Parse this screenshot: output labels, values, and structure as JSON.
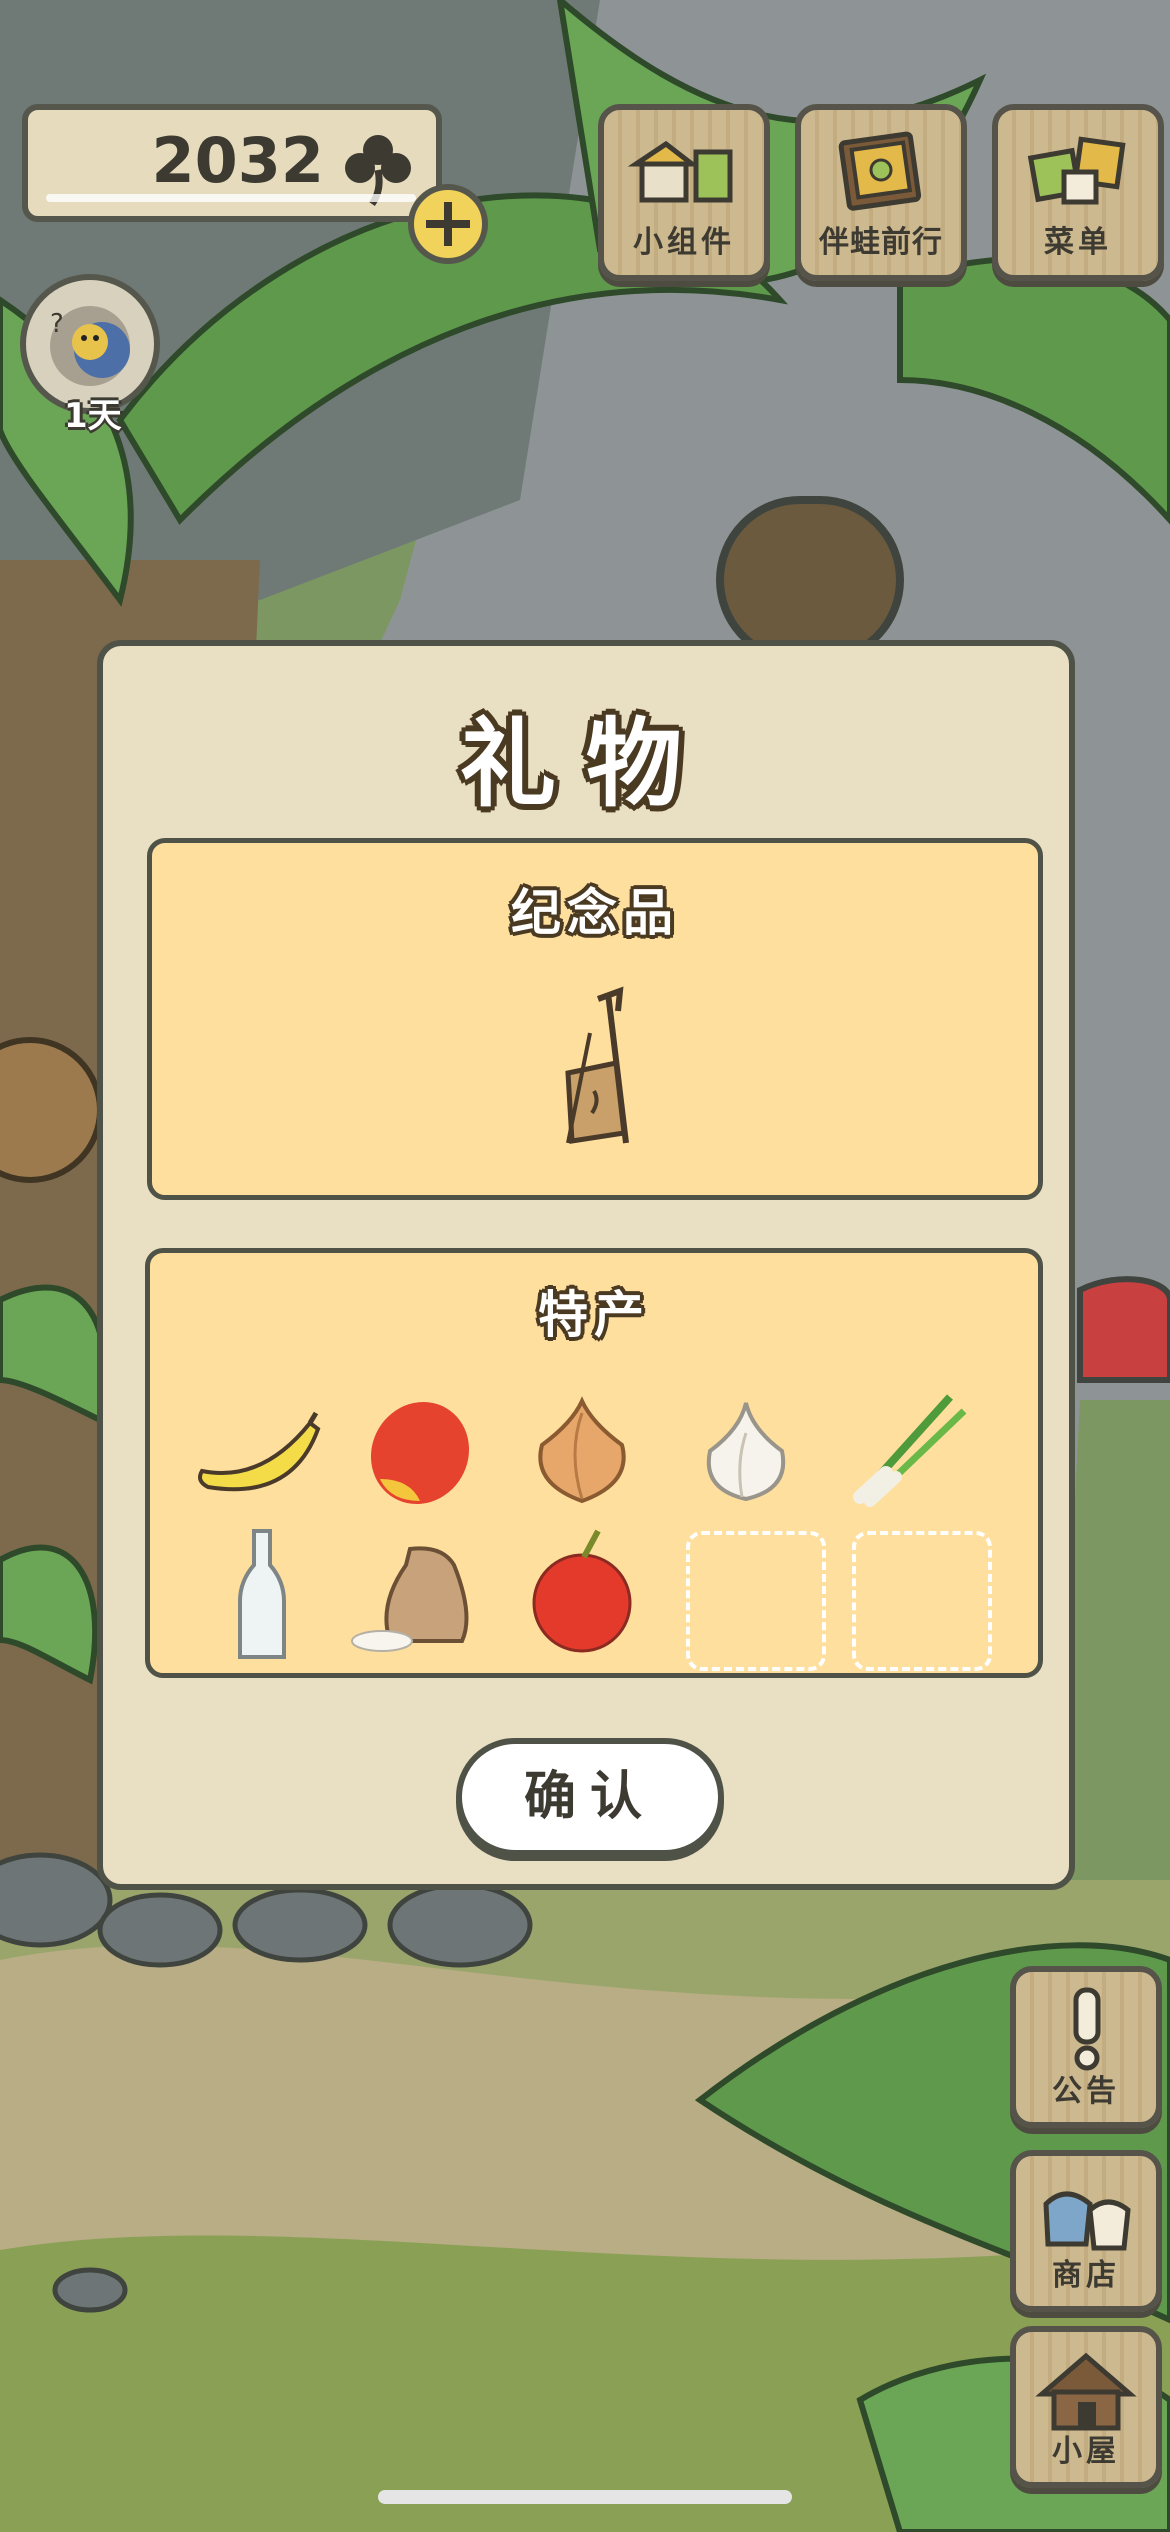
{
  "hud": {
    "clover_count": "2032",
    "clover_icon": "clover-icon",
    "add_icon": "plus-icon",
    "day_label": "1天"
  },
  "top_buttons": [
    {
      "label": "小组件",
      "icon": "widget-icon"
    },
    {
      "label": "伴蛙前行",
      "icon": "frog-album-icon"
    },
    {
      "label": "菜单",
      "icon": "menu-cards-icon"
    }
  ],
  "side_buttons": [
    {
      "label": "公告",
      "icon": "exclamation-icon"
    },
    {
      "label": "商店",
      "icon": "shop-bags-icon"
    },
    {
      "label": "小屋",
      "icon": "house-icon"
    }
  ],
  "dialog": {
    "title": "礼物",
    "souvenir": {
      "title": "纪念品",
      "item_icon": "morin-khuur-instrument-icon"
    },
    "specialty": {
      "title": "特产",
      "items": [
        {
          "icon": "banana-icon"
        },
        {
          "icon": "mango-icon"
        },
        {
          "icon": "onion-icon"
        },
        {
          "icon": "garlic-icon"
        },
        {
          "icon": "green-onion-icon"
        },
        {
          "icon": "bottle-icon"
        },
        {
          "icon": "rice-sack-icon"
        },
        {
          "icon": "apple-icon"
        },
        {
          "icon": "empty-slot"
        },
        {
          "icon": "empty-slot"
        }
      ]
    },
    "confirm_label": "确认"
  },
  "colors": {
    "panel_fill": "#ffdf9e",
    "dialog_fill": "#e9dfc3",
    "outline": "#4f5247",
    "wood": "#cdb98f"
  }
}
